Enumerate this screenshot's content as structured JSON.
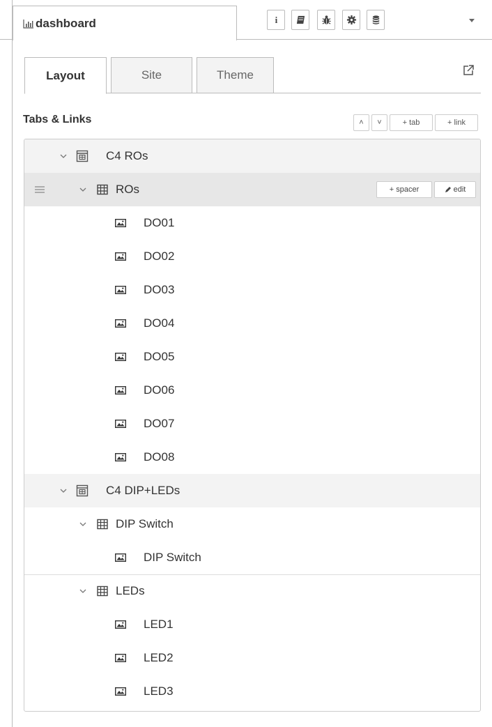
{
  "sidebar_tab": {
    "label": "dashboard",
    "icon": "bar-chart-icon"
  },
  "toolbar": {
    "buttons": [
      {
        "icon": "info-icon"
      },
      {
        "icon": "book-icon"
      },
      {
        "icon": "bug-icon"
      },
      {
        "icon": "gear-icon"
      },
      {
        "icon": "database-icon"
      }
    ],
    "more_icon": "caret-down-icon"
  },
  "subtabs": [
    {
      "label": "Layout",
      "active": true
    },
    {
      "label": "Site",
      "active": false
    },
    {
      "label": "Theme",
      "active": false
    }
  ],
  "section": {
    "title": "Tabs & Links",
    "up_label": "˄",
    "down_label": "˅",
    "add_tab_label": "+ tab",
    "add_link_label": "+ link"
  },
  "tree": {
    "group_actions": {
      "spacer_label": "+ spacer",
      "edit_label": "edit"
    },
    "tabs": [
      {
        "label": "C4 ROs",
        "groups": [
          {
            "label": "ROs",
            "selected": true,
            "widgets": [
              "DO01",
              "DO02",
              "DO03",
              "DO04",
              "DO05",
              "DO06",
              "DO07",
              "DO08"
            ]
          }
        ]
      },
      {
        "label": "C4 DIP+LEDs",
        "groups": [
          {
            "label": "DIP Switch",
            "selected": false,
            "widgets": [
              "DIP Switch"
            ]
          },
          {
            "label": "LEDs",
            "selected": false,
            "widgets": [
              "LED1",
              "LED2",
              "LED3"
            ]
          }
        ]
      }
    ]
  },
  "colors": {
    "border": "#bbbbbb",
    "tab_bg": "#f3f3f3",
    "selected_bg": "#e7e7e7"
  }
}
